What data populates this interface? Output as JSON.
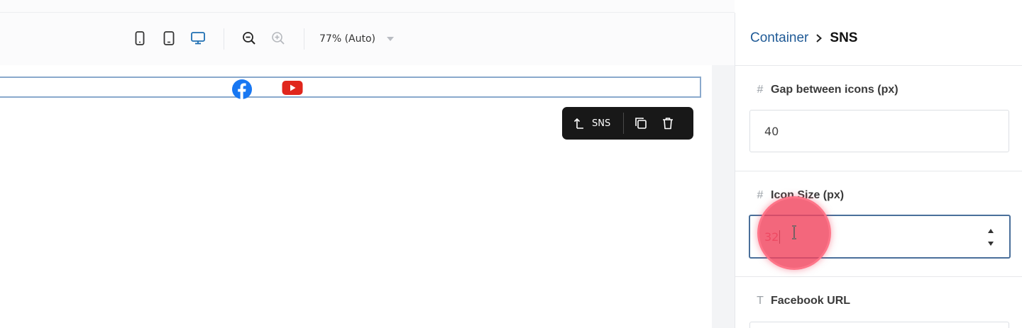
{
  "toolbar": {
    "devices": [
      "mobile-icon",
      "tablet-icon",
      "desktop-icon"
    ],
    "active_device": "desktop-icon",
    "zoom_out_icon": "zoom-out-icon",
    "zoom_in_icon": "zoom-in-icon",
    "zoom_label": "77% (Auto)",
    "accent_color": "#1f6fb2"
  },
  "canvas": {
    "sns_icons": [
      "facebook-icon",
      "youtube-icon"
    ],
    "facebook_color": "#1877f2",
    "youtube_color": "#e0261c"
  },
  "floating_toolbar": {
    "select_parent_label": "SNS",
    "duplicate_icon": "copy-icon",
    "delete_icon": "trash-icon"
  },
  "panel": {
    "breadcrumb": {
      "parent": "Container",
      "current": "SNS"
    },
    "fields": [
      {
        "icon": "#",
        "label": "Gap between icons (px)",
        "value": "40"
      },
      {
        "icon": "#",
        "label": "Icon Size (px)",
        "value": "32",
        "active": true
      },
      {
        "icon": "T",
        "label": "Facebook URL",
        "value": ""
      }
    ]
  }
}
